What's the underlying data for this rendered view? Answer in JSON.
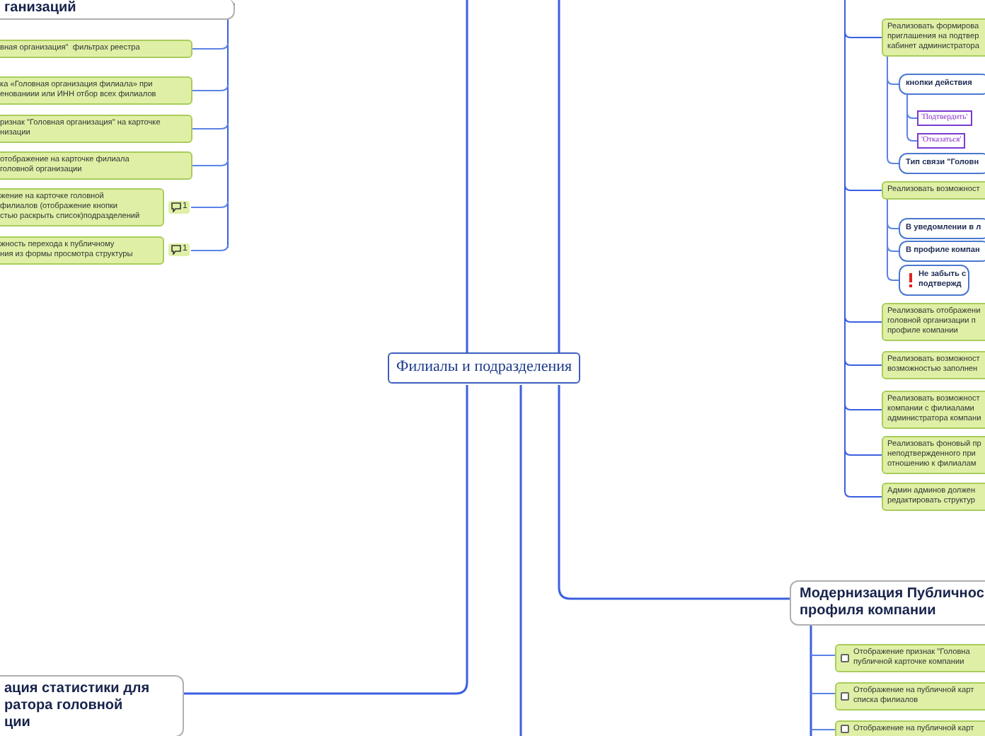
{
  "central_topic": "Филиалы и подразделения",
  "left_top_topic": {
    "title": "ганизаций",
    "items": [
      {
        "text": "вная организация\"  фильтрах реестра"
      },
      {
        "text": "ка «Головная организация филиала» при\nенованиии или ИНН отбор всех филиалов"
      },
      {
        "text": "ризнак \"Головная организация\" на карточке\nнизации"
      },
      {
        "text": "отображение на карточке филиала\nголовной организации"
      },
      {
        "text": "жение на карточке головной\nфилиалов (отображение кнопки\nстью раскрыть список)подразделений",
        "comments": "1"
      },
      {
        "text": "жность перехода к публичному\nния из формы просмотра структуры",
        "comments": "1"
      }
    ]
  },
  "left_bottom_topic": {
    "title": "ация статистики для\nратора головной\nции"
  },
  "right_branch": {
    "items": [
      {
        "kind": "task",
        "text": "Реализовать формирова\nприглашения на подтвер\nкабинет администратора",
        "children": [
          {
            "kind": "subtopic",
            "text": "кнопки действия",
            "children": [
              {
                "kind": "option",
                "text": "'Подтвердить'"
              },
              {
                "kind": "option",
                "text": "'Отказаться'"
              }
            ]
          },
          {
            "kind": "subtopic",
            "text": "Тип связи \"Головн"
          }
        ]
      },
      {
        "kind": "task",
        "text": "Реализовать возможност",
        "children": [
          {
            "kind": "subtopic",
            "text": "В уведомлении в л"
          },
          {
            "kind": "subtopic",
            "text": "В профиле компан"
          },
          {
            "kind": "note",
            "text": "Не забыть с\nподтвержд"
          }
        ]
      },
      {
        "kind": "task",
        "text": "Реализовать отображени\nголовной организации п\nпрофиле компании"
      },
      {
        "kind": "task",
        "text": "Реализовать возможност\nвозможностью заполнен"
      },
      {
        "kind": "task",
        "text": "Реализовать возможност\nкомпании с филиалами\nадминистратора компани"
      },
      {
        "kind": "task",
        "text": "Реализовать фоновый пр\nнеподтвержденного при\nотношению к филиалам"
      },
      {
        "kind": "task",
        "text": "Админ админов должен\nредактировать структур"
      }
    ]
  },
  "right_bottom_topic": {
    "title": "Модернизация Публичнос\nпрофиля компании",
    "items": [
      {
        "text": "Отображение признак \"Головна\nпубличной карточке компании",
        "checked": false
      },
      {
        "text": "Отображение на публичной карт\nсписка филиалов",
        "checked": false
      },
      {
        "text": "Отображение на публичной карт",
        "checked": false
      }
    ]
  }
}
